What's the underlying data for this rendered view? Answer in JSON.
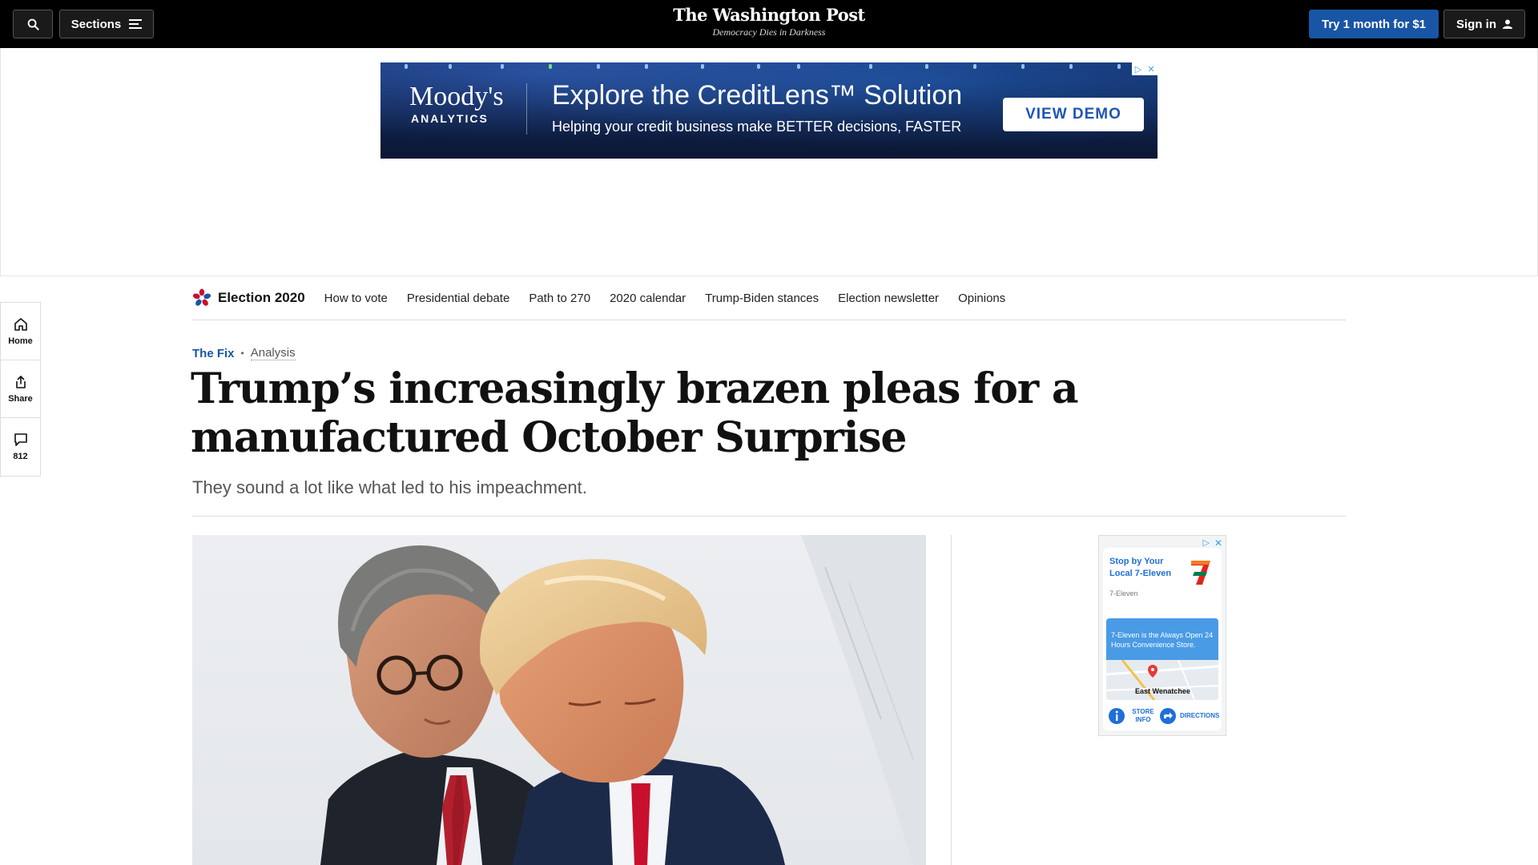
{
  "topbar": {
    "sections_label": "Sections",
    "logo_title": "The Washington Post",
    "logo_tagline": "Democracy Dies in Darkness",
    "try_label": "Try 1 month for $1",
    "signin_label": "Sign in"
  },
  "ad_banner": {
    "brand": "Moody's",
    "brand_sub": "ANALYTICS",
    "headline": "Explore the CreditLens™ Solution",
    "subline": "Helping your credit business make BETTER decisions, FASTER",
    "cta": "VIEW DEMO",
    "background_color": "#0c1a3c"
  },
  "rail": {
    "home_label": "Home",
    "share_label": "Share",
    "comments_count": "812"
  },
  "election_nav": {
    "title": "Election 2020",
    "links": [
      "How to vote",
      "Presidential debate",
      "Path to 270",
      "2020 calendar",
      "Trump-Biden stances",
      "Election newsletter",
      "Opinions"
    ]
  },
  "article": {
    "section": "The Fix",
    "label": "Analysis",
    "headline": "Trump’s increasingly brazen pleas for a manufactured October Surprise",
    "subheadline": "They sound a lot like what led to his impeachment."
  },
  "side_ad": {
    "title": "Stop by Your Local 7-Eleven",
    "brand": "7-Eleven",
    "blurb": "7-Eleven is the Always Open 24 Hours Convenience Store.",
    "place": "East Wenatchee",
    "store_info": "STORE INFO",
    "directions": "DIRECTIONS"
  },
  "colors": {
    "accent": "#1955a5",
    "topbar": "#000000"
  }
}
